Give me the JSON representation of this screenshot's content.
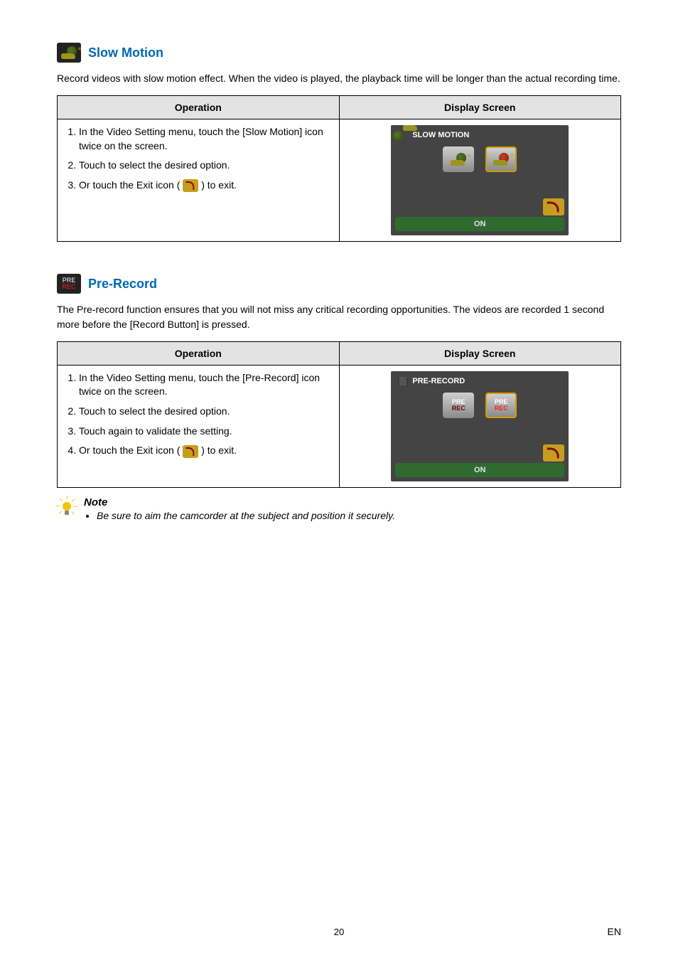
{
  "sections": {
    "slow_motion": {
      "title": "Slow Motion",
      "intro": "Record videos with slow motion effect. When the video is played, the playback time will be longer than the actual recording time.",
      "table": {
        "headers": {
          "operation": "Operation",
          "display": "Display Screen"
        },
        "steps": [
          "In the Video Setting menu, touch the [Slow Motion] icon twice on the screen.",
          "Touch to select the desired option.",
          "Or touch the Exit icon (",
          ") to exit."
        ],
        "panel": {
          "title": "SLOW MOTION",
          "on_label": "ON"
        }
      }
    },
    "pre_record": {
      "title": "Pre-Record",
      "intro": "The Pre-record function ensures that you will not miss any critical recording opportunities. The videos are recorded 1 second more before the [Record Button] is pressed.",
      "table": {
        "headers": {
          "operation": "Operation",
          "display": "Display Screen"
        },
        "steps": [
          "In the Video Setting menu, touch the [Pre-Record] icon twice on the screen.",
          "Touch to select the desired option.",
          "Touch again to validate the setting.",
          "Or touch the Exit icon (",
          ") to exit."
        ],
        "panel": {
          "title": "PRE-RECORD",
          "on_label": "ON",
          "badge": {
            "pre": "PRE",
            "rec": "REC"
          }
        }
      }
    }
  },
  "note": {
    "heading": "Note",
    "items": [
      "Be sure to aim the camcorder at the subject and position it securely."
    ]
  },
  "footer": {
    "page": "20",
    "lang": "EN"
  }
}
